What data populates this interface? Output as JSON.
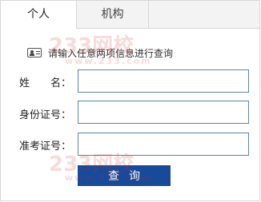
{
  "tabs": [
    {
      "label": "个人",
      "active": true
    },
    {
      "label": "机构",
      "active": false
    }
  ],
  "hint": {
    "icon": "id-card-icon",
    "text": "请输入任意两项信息进行查询"
  },
  "fields": {
    "name": {
      "label": "姓　　名：",
      "value": "",
      "placeholder": ""
    },
    "id_number": {
      "label": "身份证号：",
      "value": "",
      "placeholder": ""
    },
    "exam_number": {
      "label": "准考证号：",
      "value": "",
      "placeholder": ""
    }
  },
  "actions": {
    "query_label": "查询"
  },
  "watermark": {
    "brand": "233网校",
    "url": "www.233.com"
  },
  "colors": {
    "button_bg": "#174a9a",
    "input_border": "#5d83a7",
    "watermark": "#d82020"
  }
}
